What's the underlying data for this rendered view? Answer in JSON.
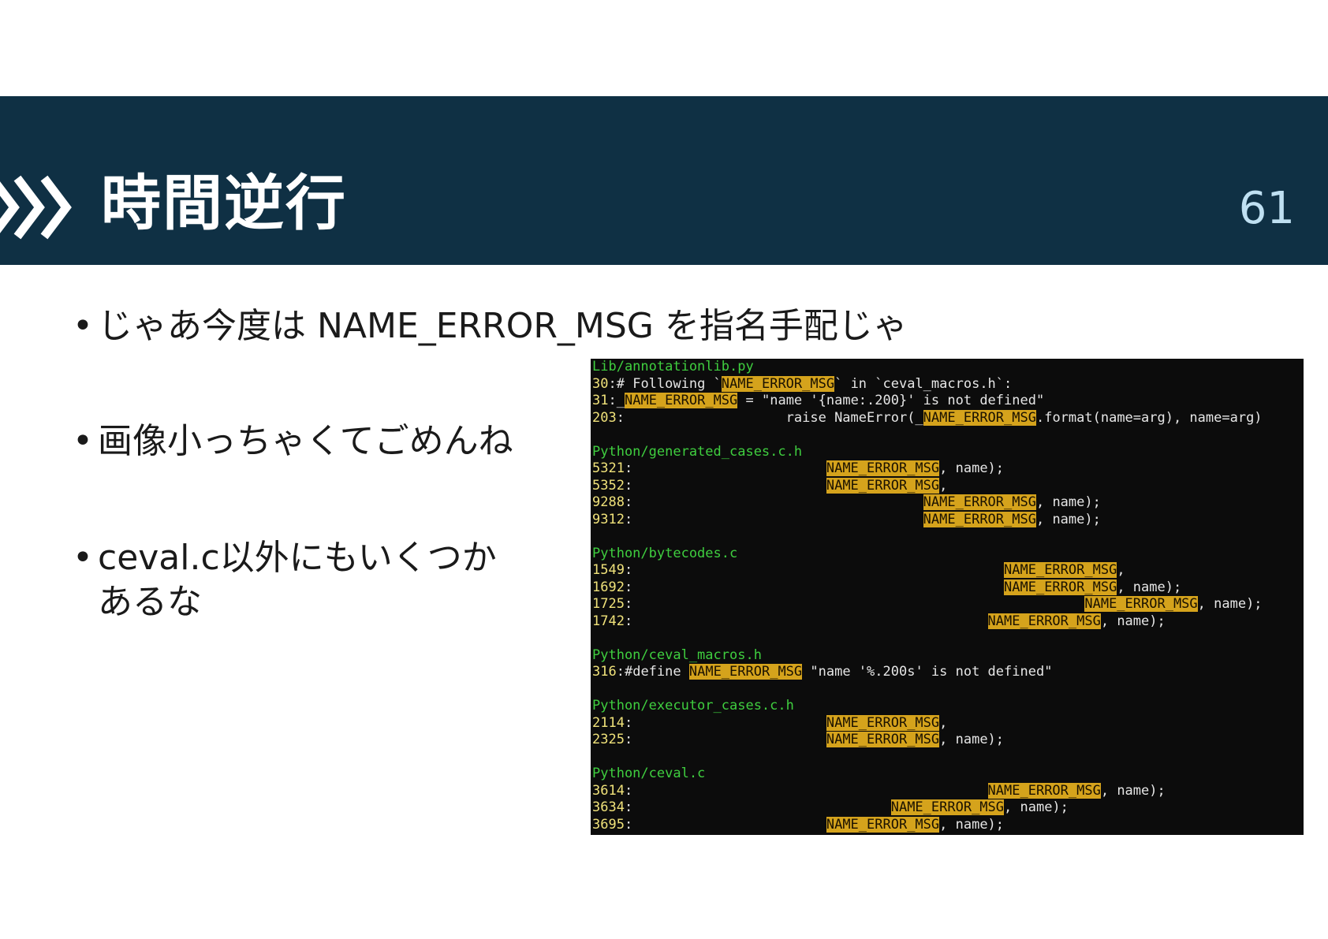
{
  "header": {
    "title": "時間逆行",
    "page_number": "61",
    "accent_color": "#0f3044",
    "icon": "triple-chevron-right-icon"
  },
  "bullets": [
    {
      "text": "じゃあ今度は NAME_ERROR_MSG を指名手配じゃ"
    },
    {
      "text": "画像小っちゃくてごめんね"
    },
    {
      "text_line1": "ceval.c以外にもいくつか",
      "text_line2": "あるな"
    }
  ],
  "terminal": {
    "highlight_color": "#d5a31c",
    "filename_color": "#3fce3f",
    "groups": [
      {
        "file": "Lib/annotationlib.py",
        "lines": [
          {
            "num": "30",
            "pre": "# Following `",
            "hl": "NAME_ERROR_MSG",
            "post": "` in `ceval_macros.h`:"
          },
          {
            "num": "31",
            "pre": "_",
            "hl": "NAME_ERROR_MSG",
            "post": " = \"name '{name:.200}' is not defined\""
          },
          {
            "num": "203",
            "pre": "                    raise NameError(_",
            "hl": "NAME_ERROR_MSG",
            "post": ".format(name=arg), name=arg)"
          }
        ]
      },
      {
        "file": "Python/generated_cases.c.h",
        "lines": [
          {
            "num": "5321",
            "pre": "                        ",
            "hl": "NAME_ERROR_MSG",
            "post": ", name);"
          },
          {
            "num": "5352",
            "pre": "                        ",
            "hl": "NAME_ERROR_MSG",
            "post": ","
          },
          {
            "num": "9288",
            "pre": "                                    ",
            "hl": "NAME_ERROR_MSG",
            "post": ", name);"
          },
          {
            "num": "9312",
            "pre": "                                    ",
            "hl": "NAME_ERROR_MSG",
            "post": ", name);"
          }
        ]
      },
      {
        "file": "Python/bytecodes.c",
        "lines": [
          {
            "num": "1549",
            "pre": "                                              ",
            "hl": "NAME_ERROR_MSG",
            "post": ","
          },
          {
            "num": "1692",
            "pre": "                                              ",
            "hl": "NAME_ERROR_MSG",
            "post": ", name);"
          },
          {
            "num": "1725",
            "pre": "                                                        ",
            "hl": "NAME_ERROR_MSG",
            "post": ", name);"
          },
          {
            "num": "1742",
            "pre": "                                            ",
            "hl": "NAME_ERROR_MSG",
            "post": ", name);"
          }
        ]
      },
      {
        "file": "Python/ceval_macros.h",
        "lines": [
          {
            "num": "316",
            "pre": "#define ",
            "hl": "NAME_ERROR_MSG",
            "post": " \"name '%.200s' is not defined\""
          }
        ]
      },
      {
        "file": "Python/executor_cases.c.h",
        "lines": [
          {
            "num": "2114",
            "pre": "                        ",
            "hl": "NAME_ERROR_MSG",
            "post": ","
          },
          {
            "num": "2325",
            "pre": "                        ",
            "hl": "NAME_ERROR_MSG",
            "post": ", name);"
          }
        ]
      },
      {
        "file": "Python/ceval.c",
        "lines": [
          {
            "num": "3614",
            "pre": "                                            ",
            "hl": "NAME_ERROR_MSG",
            "post": ", name);"
          },
          {
            "num": "3634",
            "pre": "                                ",
            "hl": "NAME_ERROR_MSG",
            "post": ", name);"
          },
          {
            "num": "3695",
            "pre": "                        ",
            "hl": "NAME_ERROR_MSG",
            "post": ", name);"
          }
        ]
      }
    ]
  }
}
